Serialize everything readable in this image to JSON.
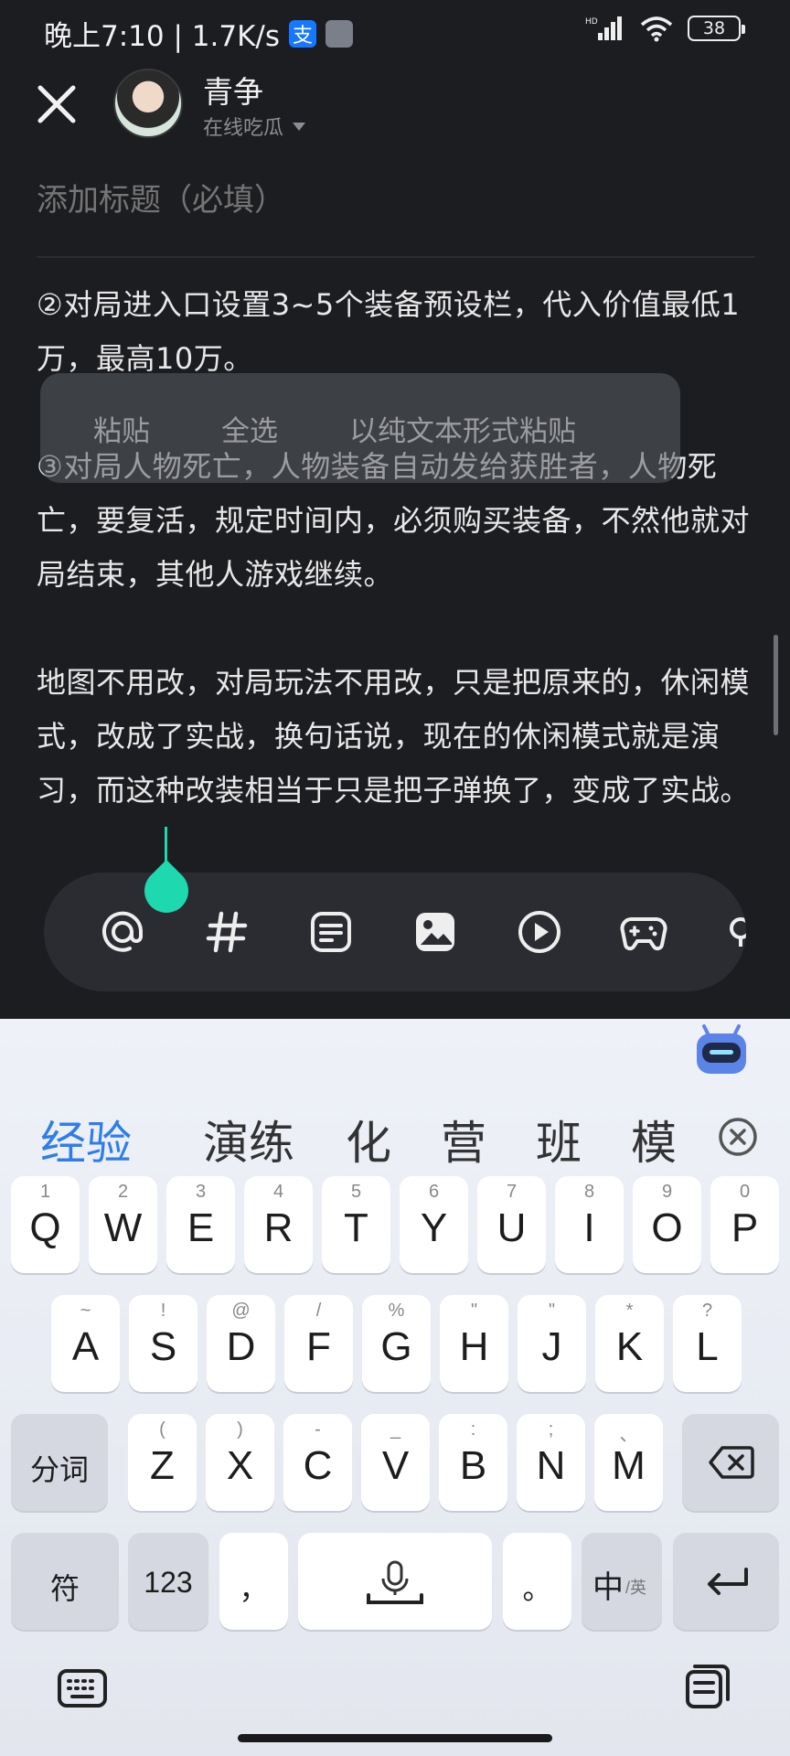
{
  "status_bar": {
    "time_speed": "晚上7:10 | 1.7K/s",
    "pay_badge": "支",
    "battery": "38",
    "network": "HD"
  },
  "header": {
    "username": "青争",
    "status": "在线吃瓜"
  },
  "editor": {
    "title_placeholder": "添加标题（必填）",
    "paragraphs": [
      "②对局进入口设置3~5个装备预设栏，代入价值最低1万，最高10万。",
      "",
      "③对局人物死亡，人物装备自动发给获胜者，人物死亡，要复活，规定时间内，必须购买装备，不然他就对局结束，其他人游戏继续。",
      "",
      "地图不用改，对局玩法不用改，只是把原来的，休闲模式，改成了实战，换句话说，现在的休闲模式就是演习，而这种改装相当于只是把子弹换了，变成了实战。"
    ]
  },
  "context_menu": {
    "paste": "粘贴",
    "select_all": "全选",
    "paste_plain": "以纯文本形式粘贴"
  },
  "toolbar": {
    "icons": [
      "at-icon",
      "hashtag-icon",
      "document-icon",
      "image-icon",
      "video-icon",
      "game-controller-icon",
      "more-icon"
    ]
  },
  "keyboard": {
    "candidates": [
      "经验",
      "演练",
      "化",
      "营",
      "班",
      "模"
    ],
    "row1": [
      {
        "k": "Q",
        "s": "1"
      },
      {
        "k": "W",
        "s": "2"
      },
      {
        "k": "E",
        "s": "3"
      },
      {
        "k": "R",
        "s": "4"
      },
      {
        "k": "T",
        "s": "5"
      },
      {
        "k": "Y",
        "s": "6"
      },
      {
        "k": "U",
        "s": "7"
      },
      {
        "k": "I",
        "s": "8"
      },
      {
        "k": "O",
        "s": "9"
      },
      {
        "k": "P",
        "s": "0"
      }
    ],
    "row2": [
      {
        "k": "A",
        "s": "~"
      },
      {
        "k": "S",
        "s": "!"
      },
      {
        "k": "D",
        "s": "@"
      },
      {
        "k": "F",
        "s": "/"
      },
      {
        "k": "G",
        "s": "%"
      },
      {
        "k": "H",
        "s": "\""
      },
      {
        "k": "J",
        "s": "\""
      },
      {
        "k": "K",
        "s": "*"
      },
      {
        "k": "L",
        "s": "?"
      }
    ],
    "row3": [
      {
        "k": "Z",
        "s": "("
      },
      {
        "k": "X",
        "s": ")"
      },
      {
        "k": "C",
        "s": "-"
      },
      {
        "k": "V",
        "s": "_"
      },
      {
        "k": "B",
        "s": ":"
      },
      {
        "k": "N",
        "s": ";"
      },
      {
        "k": "M",
        "s": "、"
      }
    ],
    "segment_key": "分词",
    "symbol_key": "符",
    "num_key": "123",
    "comma_key": "，",
    "period_key": "。",
    "lang_key_main": "中",
    "lang_key_sub": "/英"
  }
}
